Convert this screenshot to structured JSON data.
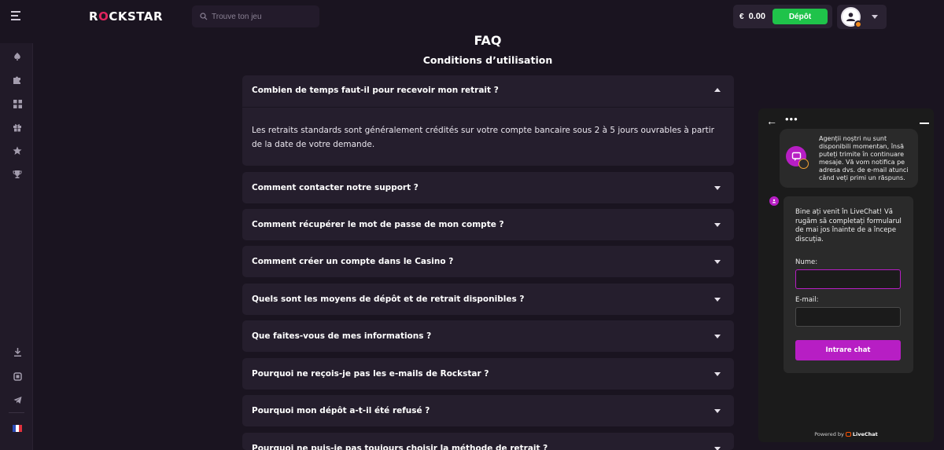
{
  "header": {
    "logo_prefix": "R",
    "logo_o": "O",
    "logo_suffix": "CKSTAR",
    "search_placeholder": "Trouve ton jeu",
    "currency_symbol": "€",
    "balance": "0.00",
    "deposit_label": "Dépôt"
  },
  "sidebar": {
    "icons": [
      "spade-icon",
      "puzzle-icon",
      "grid-icon",
      "gift-icon",
      "star-icon",
      "trophy-icon",
      "download-icon",
      "square-icon",
      "telegram-icon",
      "flag-fr-icon"
    ]
  },
  "main": {
    "title": "FAQ",
    "subtitle": "Conditions d’utilisation",
    "faqs": [
      {
        "question": "Combien de temps faut-il pour recevoir mon retrait ?",
        "answer": "Les retraits standards sont généralement crédités sur votre compte bancaire sous 2 à 5 jours ouvrables à partir de la date de votre demande.",
        "expanded": true
      },
      {
        "question": "Comment contacter notre support ?",
        "expanded": false
      },
      {
        "question": "Comment récupérer le mot de passe de mon compte ?",
        "expanded": false
      },
      {
        "question": "Comment créer un compte dans le Casino ?",
        "expanded": false
      },
      {
        "question": "Quels sont les moyens de dépôt et de retrait disponibles ?",
        "expanded": false
      },
      {
        "question": "Que faites-vous de mes informations ?",
        "expanded": false
      },
      {
        "question": "Pourquoi ne reçois-je pas les e-mails de Rockstar ?",
        "expanded": false
      },
      {
        "question": "Pourquoi mon dépôt a-t-il été refusé ?",
        "expanded": false
      },
      {
        "question": "Pourquoi ne puis-je pas toujours choisir la méthode de retrait ?",
        "expanded": false
      }
    ]
  },
  "chat": {
    "back_glyph": "←",
    "menu_glyph": "•••",
    "notice": "Agenții noștri nu sunt disponibili momentan, însă puteți trimite în continuare mesaje. Vă vom notifica pe adresa dvs. de e-mail atunci când veți primi un răspuns.",
    "intro": "Bine ați venit în LiveChat! Vă rugăm să completați formularul de mai jos înainte de a începe discuția.",
    "name_label": "Nume:",
    "email_label": "E-mail:",
    "submit_label": "Intrare chat",
    "powered_prefix": "Powered by",
    "powered_brand": "LiveChat"
  },
  "colors": {
    "background": "#1a1420",
    "card": "#251e2d",
    "deposit_green": "#1fc34a",
    "livechat_magenta": "#b71ec4"
  }
}
